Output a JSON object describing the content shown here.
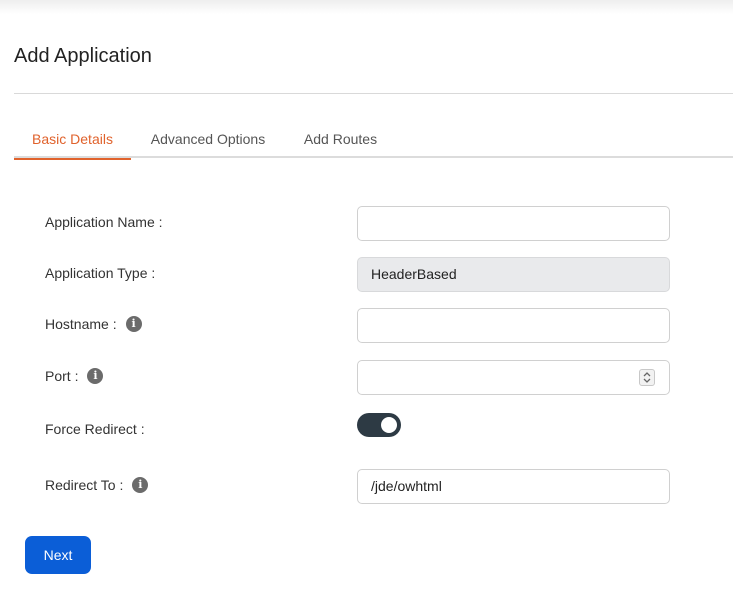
{
  "page": {
    "title": "Add Application"
  },
  "tabs": [
    {
      "label": "Basic Details",
      "active": true
    },
    {
      "label": "Advanced Options",
      "active": false
    },
    {
      "label": "Add Routes",
      "active": false
    }
  ],
  "form": {
    "application_name": {
      "label": "Application Name :",
      "value": ""
    },
    "application_type": {
      "label": "Application Type :",
      "value": "HeaderBased"
    },
    "hostname": {
      "label": "Hostname :",
      "value": "",
      "info_icon": "info-icon"
    },
    "port": {
      "label": "Port :",
      "value": "",
      "info_icon": "info-icon"
    },
    "force_redirect": {
      "label": "Force Redirect :",
      "enabled": true
    },
    "redirect_to": {
      "label": "Redirect To :",
      "value": "/jde/owhtml",
      "info_icon": "info-icon"
    }
  },
  "actions": {
    "next_label": "Next"
  },
  "colors": {
    "accent_tab": "#e0622c",
    "primary_button": "#0b5ed7",
    "toggle_on": "#2d3a44",
    "disabled_field": "#e9eaec"
  }
}
